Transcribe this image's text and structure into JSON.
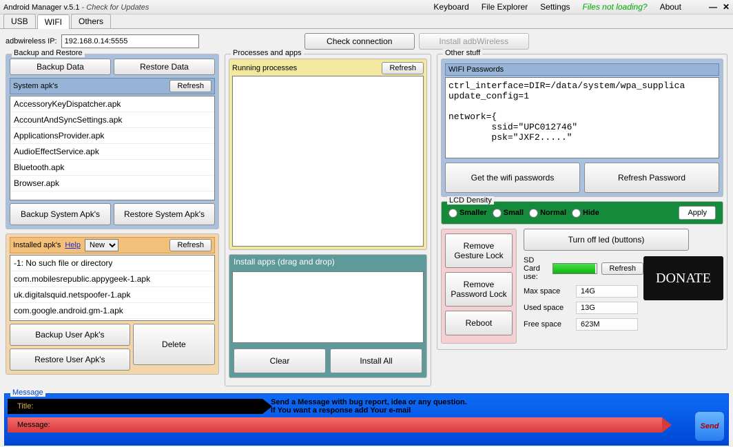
{
  "title": {
    "app": "Android Manager v.5.1",
    "sub": " - Check for Updates"
  },
  "menu": {
    "keyboard": "Keyboard",
    "fileexp": "File Explorer",
    "settings": "Settings",
    "fnl": "Files not loading?",
    "about": "About"
  },
  "tabs": [
    "USB",
    "WIFI",
    "Others"
  ],
  "adb": {
    "label": "adbwireless IP:",
    "value": "192.168.0.14:5555",
    "check": "Check connection",
    "install": "Install adbWireless"
  },
  "backup": {
    "legend": "Backup and Restore",
    "backupData": "Backup Data",
    "restoreData": "Restore Data",
    "sysapk": "System apk's",
    "refresh": "Refresh",
    "items": [
      "AccessoryKeyDispatcher.apk",
      "AccountAndSyncSettings.apk",
      "ApplicationsProvider.apk",
      "AudioEffectService.apk",
      "Bluetooth.apk",
      "Browser.apk"
    ],
    "backupSys": "Backup System Apk's",
    "restoreSys": "Restore System Apk's"
  },
  "installed": {
    "label": "Installed apk's",
    "help": "Help",
    "new": "New",
    "refresh": "Refresh",
    "items": [
      "-1: No such file or directory",
      "com.mobilesrepublic.appygeek-1.apk",
      "uk.digitalsquid.netspoofer-1.apk",
      "com.google.android.gm-1.apk"
    ],
    "backupUser": "Backup User Apk's",
    "restoreUser": "Restore User Apk's",
    "delete": "Delete"
  },
  "proc": {
    "legend": "Processes and apps",
    "running": "Running processes",
    "refresh": "Refresh",
    "installHdr": "Install apps (drag and drop)",
    "clear": "Clear",
    "installAll": "Install All"
  },
  "other": {
    "legend": "Other stuff",
    "wifiHdr": "WIFI Passwords",
    "wifiText": "ctrl_interface=DIR=/data/system/wpa_supplica\nupdate_config=1\n\nnetwork={\n        ssid=\"UPC012746\"\n        psk=\"JXF2.....\"",
    "getWifi": "Get the wifi passwords",
    "refreshPw": "Refresh Password",
    "lcd": {
      "legend": "LCD Density",
      "smaller": "Smaller",
      "small": "Small",
      "normal": "Normal",
      "hide": "Hide",
      "apply": "Apply"
    },
    "gesture": "Remove Gesture Lock",
    "pwlock": "Remove Password Lock",
    "reboot": "Reboot",
    "led": "Turn off led (buttons)",
    "sd": {
      "use": "SD Card use:",
      "refresh": "Refresh",
      "max": "Max space",
      "maxv": "14G",
      "used": "Used space",
      "usedv": "13G",
      "free": "Free space",
      "freev": "623M"
    },
    "donate": "DONATE"
  },
  "msg": {
    "legend": "Message",
    "title": "Title:",
    "message": "Message:",
    "line1": "Send a Message with bug report, idea or any question.",
    "line2": "If You want a response add Your e-mail",
    "send": "Send"
  }
}
